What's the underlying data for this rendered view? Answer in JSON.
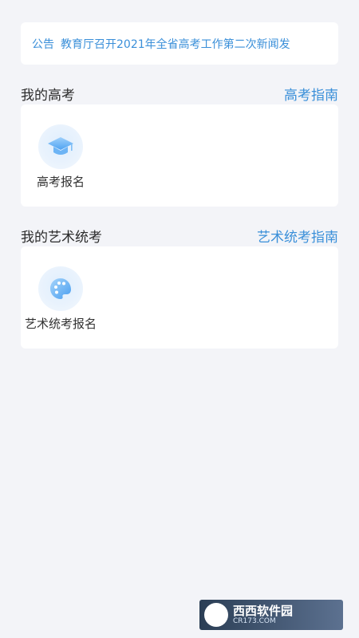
{
  "notice": {
    "tag": "公告",
    "text": "教育厅召开2021年全省高考工作第二次新闻发"
  },
  "gaokao": {
    "title": "我的高考",
    "guide_link": "高考指南",
    "entries": [
      {
        "label": "高考报名",
        "icon": "graduation-cap-icon"
      }
    ]
  },
  "art_exam": {
    "title": "我的艺术统考",
    "guide_link": "艺术统考指南",
    "entries": [
      {
        "label": "艺术统考报名",
        "icon": "palette-icon"
      }
    ]
  },
  "watermark": {
    "text": "西西软件园",
    "sub": "CR173.COM"
  },
  "colors": {
    "accent": "#3a8fd9",
    "background": "#f3f4f8",
    "card": "#ffffff",
    "text": "#2b2b2b"
  }
}
